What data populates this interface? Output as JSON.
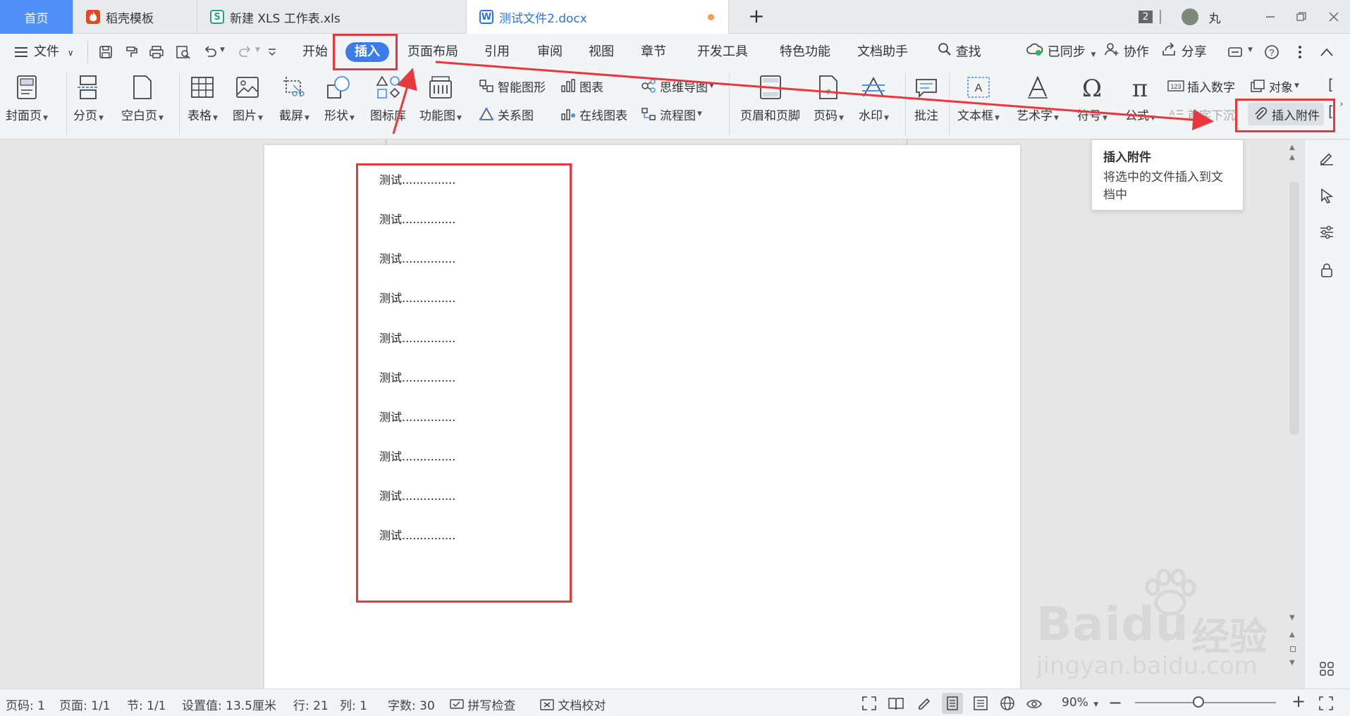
{
  "tabs": {
    "home": "首页",
    "daoke": "稻壳模板",
    "xls": "新建 XLS 工作表.xls",
    "docx": "测试文件2.docx",
    "new_tab": "+"
  },
  "titlebar": {
    "badge": "2",
    "user": "丸"
  },
  "menu": {
    "file": "文件",
    "start": "开始",
    "insert": "插入",
    "page_layout": "页面布局",
    "reference": "引用",
    "review": "审阅",
    "view": "视图",
    "chapter": "章节",
    "dev_tools": "开发工具",
    "special": "特色功能",
    "doc_assistant": "文档助手",
    "find": "查找",
    "synced": "已同步",
    "collab": "协作",
    "share": "分享"
  },
  "ribbon": {
    "cover": "封面页",
    "page_break": "分页",
    "blank_page": "空白页",
    "table": "表格",
    "picture": "图片",
    "screenshot": "截屏",
    "shape": "形状",
    "icon_lib": "图标库",
    "func_chart": "功能图",
    "smart_art": "智能图形",
    "chart": "图表",
    "mindmap": "思维导图",
    "relation": "关系图",
    "online_chart": "在线图表",
    "flowchart": "流程图",
    "header_footer": "页眉和页脚",
    "page_num": "页码",
    "watermark": "水印",
    "comment": "批注",
    "textbox": "文本框",
    "wordart": "艺术字",
    "symbol": "符号",
    "formula": "公式",
    "insert_number": "插入数字",
    "object": "对象",
    "drop_cap": "首字下沉",
    "insert_attachment": "插入附件"
  },
  "tooltip": {
    "title": "插入附件",
    "desc": "将选中的文件插入到文档中"
  },
  "document": {
    "lines": [
      "测试...............",
      "测试...............",
      "测试...............",
      "测试...............",
      "测试...............",
      "测试...............",
      "测试...............",
      "测试...............",
      "测试...............",
      "测试..............."
    ]
  },
  "status": {
    "page_code": "页码: 1",
    "pages": "页面: 1/1",
    "section": "节: 1/1",
    "setting": "设置值: 13.5厘米",
    "row": "行: 21",
    "col": "列: 1",
    "word_count": "字数: 30",
    "spell_check": "拼写检查",
    "doc_proof": "文档校对",
    "zoom": "90%"
  },
  "watermark": {
    "brand": "Bai",
    "brand2": "du",
    "cn": "经验",
    "url": "jingyan.baidu.com"
  },
  "colors": {
    "accent": "#3b7bea",
    "annotation": "#e8383d",
    "home_tab": "#4e8ff8"
  }
}
